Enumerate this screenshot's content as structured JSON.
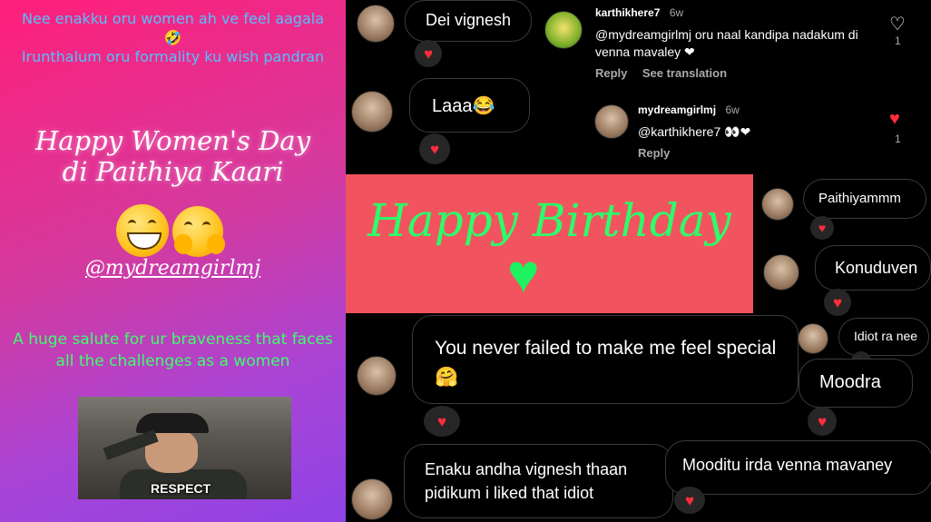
{
  "left_card": {
    "intro_line1": "Nee enakku oru women ah ve feel aagala 🤣",
    "intro_line2": "Irunthalum oru formality ku wish pandran",
    "greeting_line1": "Happy Women's Day",
    "greeting_line2": "di Paithiya Kaari",
    "handle": "@mydreamgirlmj",
    "salute_text": "A huge salute for ur braveness that faces all the challenges as a women",
    "gif_caption": "RESPECT"
  },
  "birthday_banner": {
    "title": "Happy Birthday",
    "heart": "♥"
  },
  "bubbles": {
    "dei": "Dei vignesh",
    "laaa": "Laaa😂",
    "paithiyammm": "Paithiyammm",
    "konuduven": "Konuduven",
    "idiot": "Idiot ra nee",
    "moodra": "Moodra",
    "special": "You never failed to make me feel special🤗",
    "enaku": "Enaku andha vignesh thaan pidikum i liked that idiot",
    "mooditu": "Mooditu irda venna mavaney"
  },
  "heart_glyph": "♥",
  "comments": [
    {
      "user": "karthikhere7",
      "time": "6w",
      "text": "@mydreamgirlmj oru naal kandipa nadakum di venna mavaley ❤",
      "reply": "Reply",
      "translate": "See translation",
      "likes": "1"
    },
    {
      "user": "mydreamgirlmj",
      "time": "6w",
      "text": "@karthikhere7 👀❤",
      "reply": "Reply",
      "likes": "1"
    }
  ],
  "colors": {
    "accent_heart": "#ff2d3c",
    "banner_bg": "#f2545f",
    "banner_text": "#2bff6b",
    "left_blue": "#4fc3ff",
    "left_green": "#3cff6a"
  }
}
